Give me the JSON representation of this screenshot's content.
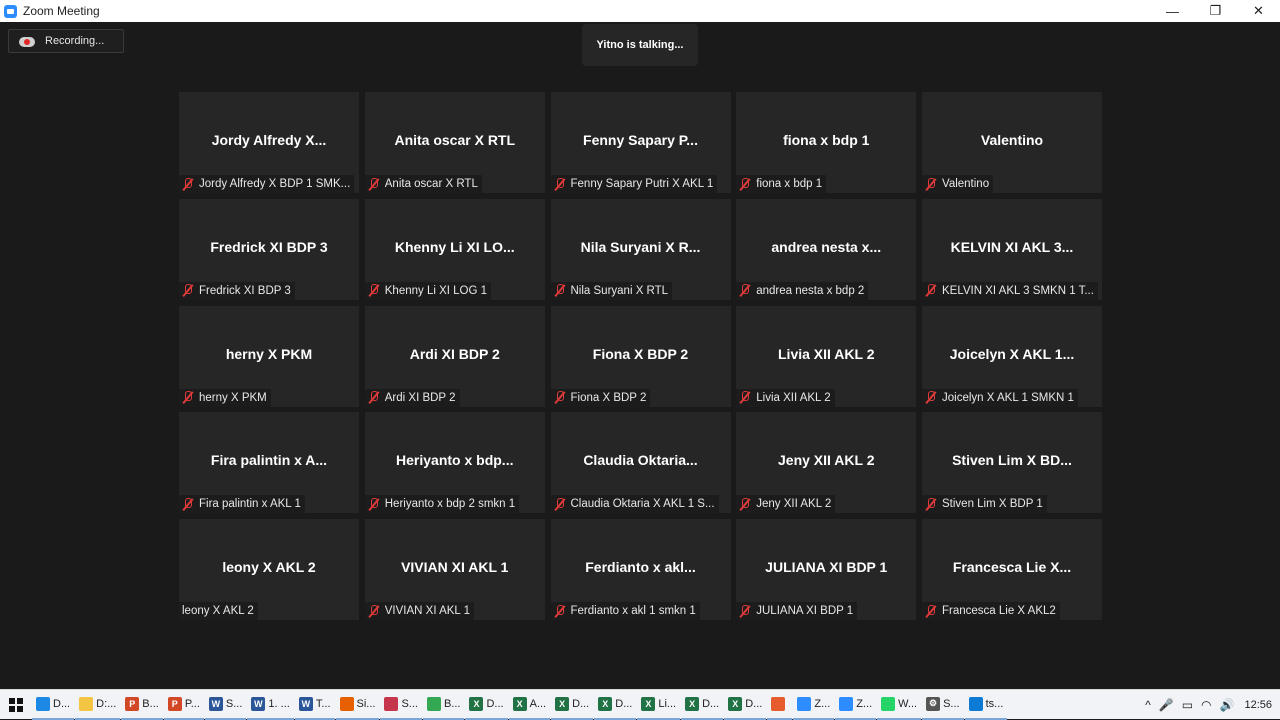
{
  "window": {
    "title": "Zoom Meeting",
    "minimize": "—",
    "restore": "❐",
    "close": "✕"
  },
  "recording": {
    "label": "Recording..."
  },
  "talking": {
    "text": "Yitno is talking..."
  },
  "participants": [
    {
      "display": "Jordy Alfredy X...",
      "label": "Jordy Alfredy X BDP 1 SMK...",
      "muted": true
    },
    {
      "display": "Anita oscar X RTL",
      "label": "Anita oscar X RTL",
      "muted": true
    },
    {
      "display": "Fenny Sapary P...",
      "label": "Fenny Sapary Putri X AKL 1",
      "muted": true
    },
    {
      "display": "fiona x bdp 1",
      "label": "fiona x bdp 1",
      "muted": true
    },
    {
      "display": "Valentino",
      "label": "Valentino",
      "muted": true
    },
    {
      "display": "Fredrick XI BDP 3",
      "label": "Fredrick XI BDP 3",
      "muted": true
    },
    {
      "display": "Khenny Li XI LO...",
      "label": "Khenny Li XI LOG 1",
      "muted": true
    },
    {
      "display": "Nila Suryani X R...",
      "label": "Nila Suryani X RTL",
      "muted": true
    },
    {
      "display": "andrea nesta x...",
      "label": "andrea nesta x bdp 2",
      "muted": true
    },
    {
      "display": "KELVIN XI AKL 3...",
      "label": "KELVIN XI AKL 3 SMKN 1 T...",
      "muted": true
    },
    {
      "display": "herny X PKM",
      "label": "herny X PKM",
      "muted": true
    },
    {
      "display": "Ardi XI BDP 2",
      "label": "Ardi XI BDP 2",
      "muted": true
    },
    {
      "display": "Fiona X BDP 2",
      "label": "Fiona X BDP 2",
      "muted": true
    },
    {
      "display": "Livia XII AKL 2",
      "label": "Livia XII AKL 2",
      "muted": true
    },
    {
      "display": "Joicelyn X AKL 1...",
      "label": "Joicelyn X AKL 1 SMKN 1",
      "muted": true
    },
    {
      "display": "Fira palintin x A...",
      "label": "Fira palintin x AKL 1",
      "muted": true
    },
    {
      "display": "Heriyanto x bdp...",
      "label": "Heriyanto x bdp 2 smkn 1",
      "muted": true
    },
    {
      "display": "Claudia Oktaria...",
      "label": "Claudia Oktaria X AKL 1 S...",
      "muted": true
    },
    {
      "display": "Jeny XII AKL 2",
      "label": "Jeny XII AKL 2",
      "muted": true
    },
    {
      "display": "Stiven Lim X BD...",
      "label": "Stiven Lim X BDP 1",
      "muted": true
    },
    {
      "display": "leony X AKL 2",
      "label": "leony X AKL 2",
      "muted": false
    },
    {
      "display": "VIVIAN XI AKL 1",
      "label": "VIVIAN XI AKL 1",
      "muted": true
    },
    {
      "display": "Ferdianto x akl...",
      "label": "Ferdianto x akl 1 smkn 1",
      "muted": true
    },
    {
      "display": "JULIANA XI BDP 1",
      "label": "JULIANA XI BDP 1",
      "muted": true
    },
    {
      "display": "Francesca Lie X...",
      "label": "Francesca Lie X AKL2",
      "muted": true
    }
  ],
  "taskbar": {
    "items": [
      {
        "label": "D...",
        "icon": "desktop-icon",
        "color": "#1e88e5",
        "glyph": ""
      },
      {
        "label": "D:...",
        "icon": "folder-icon",
        "color": "#f4c542",
        "glyph": ""
      },
      {
        "label": "B...",
        "icon": "powerpoint-icon",
        "color": "#d24726",
        "glyph": "P"
      },
      {
        "label": "P...",
        "icon": "powerpoint-icon",
        "color": "#d24726",
        "glyph": "P"
      },
      {
        "label": "S...",
        "icon": "word-icon",
        "color": "#2b579a",
        "glyph": "W"
      },
      {
        "label": "1. ...",
        "icon": "word-icon",
        "color": "#2b579a",
        "glyph": "W"
      },
      {
        "label": "T...",
        "icon": "word-icon",
        "color": "#2b579a",
        "glyph": "W"
      },
      {
        "label": "Si...",
        "icon": "firefox-icon",
        "color": "#e66000",
        "glyph": ""
      },
      {
        "label": "S...",
        "icon": "snipping-icon",
        "color": "#c7354c",
        "glyph": ""
      },
      {
        "label": "B...",
        "icon": "chrome-icon",
        "color": "#34a853",
        "glyph": ""
      },
      {
        "label": "D...",
        "icon": "excel-icon",
        "color": "#217346",
        "glyph": "X"
      },
      {
        "label": "A...",
        "icon": "excel-icon",
        "color": "#217346",
        "glyph": "X"
      },
      {
        "label": "D...",
        "icon": "excel-icon",
        "color": "#217346",
        "glyph": "X"
      },
      {
        "label": "D...",
        "icon": "excel-icon",
        "color": "#217346",
        "glyph": "X"
      },
      {
        "label": "Li...",
        "icon": "excel-icon",
        "color": "#217346",
        "glyph": "X"
      },
      {
        "label": "D...",
        "icon": "excel-icon",
        "color": "#217346",
        "glyph": "X"
      },
      {
        "label": "D...",
        "icon": "excel-icon",
        "color": "#217346",
        "glyph": "X"
      },
      {
        "label": "",
        "icon": "app-icon",
        "color": "#e55b2d",
        "glyph": ""
      },
      {
        "label": "Z...",
        "icon": "zoom-icon",
        "color": "#2d8cff",
        "glyph": ""
      },
      {
        "label": "Z...",
        "icon": "zoom-icon",
        "color": "#2d8cff",
        "glyph": ""
      },
      {
        "label": "W...",
        "icon": "whatsapp-icon",
        "color": "#25d366",
        "glyph": ""
      },
      {
        "label": "S...",
        "icon": "settings-icon",
        "color": "#555555",
        "glyph": "⚙"
      },
      {
        "label": "ts...",
        "icon": "edge-icon",
        "color": "#0c7bd6",
        "glyph": ""
      }
    ],
    "tray": {
      "chevron": "^",
      "mic": "🎤",
      "battery": "▭",
      "wifi": "◠",
      "volume": "🔊",
      "time": "12:56"
    }
  }
}
